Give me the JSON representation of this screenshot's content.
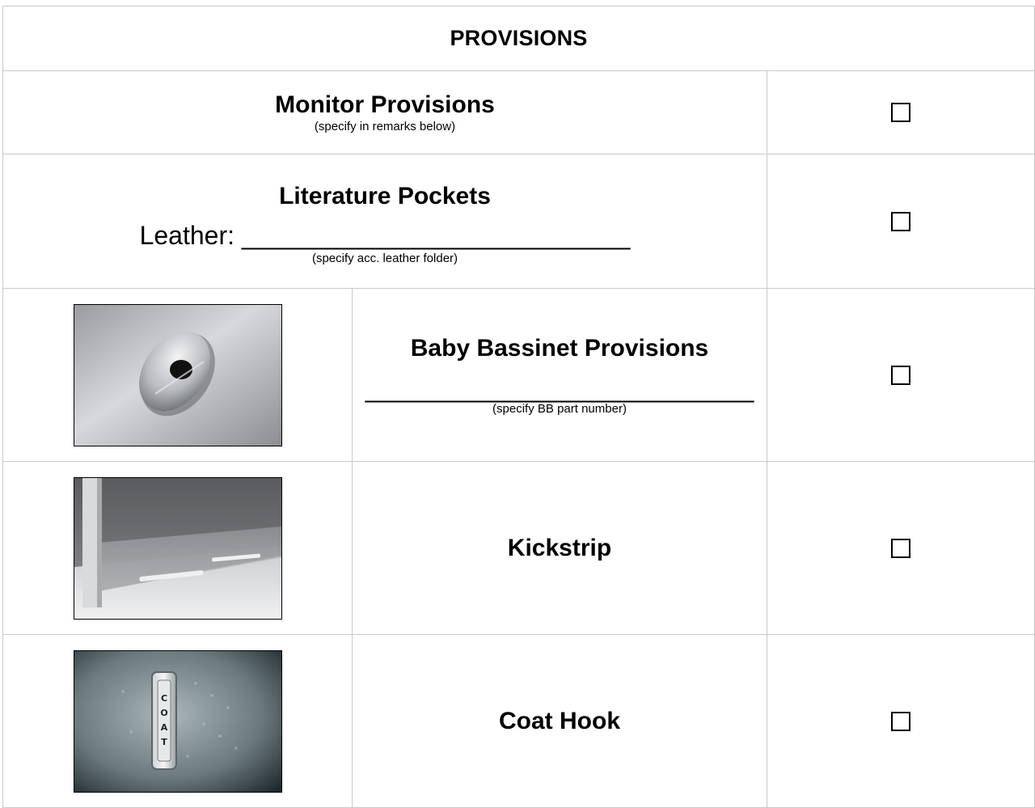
{
  "header": {
    "title": "PROVISIONS"
  },
  "rows": {
    "monitor": {
      "title": "Monitor Provisions",
      "note": "(specify in remarks below)"
    },
    "literature": {
      "title": "Literature Pockets",
      "leather_label": "Leather: ",
      "leather_blank": "___________________________",
      "note": "(specify acc. leather folder)"
    },
    "bassinet": {
      "title": "Baby Bassinet Provisions",
      "blank": "___________________________",
      "note": "(specify BB part number)",
      "image_icon": "bassinet-fitting-photo"
    },
    "kickstrip": {
      "title": "Kickstrip",
      "image_icon": "kickstrip-photo"
    },
    "coathook": {
      "title": "Coat Hook",
      "image_icon": "coat-hook-photo",
      "image_label": "COAT"
    }
  },
  "checkbox_glyph": "empty-square-checkbox",
  "colors": {
    "border": "#c9c9c9",
    "text": "#000000"
  }
}
